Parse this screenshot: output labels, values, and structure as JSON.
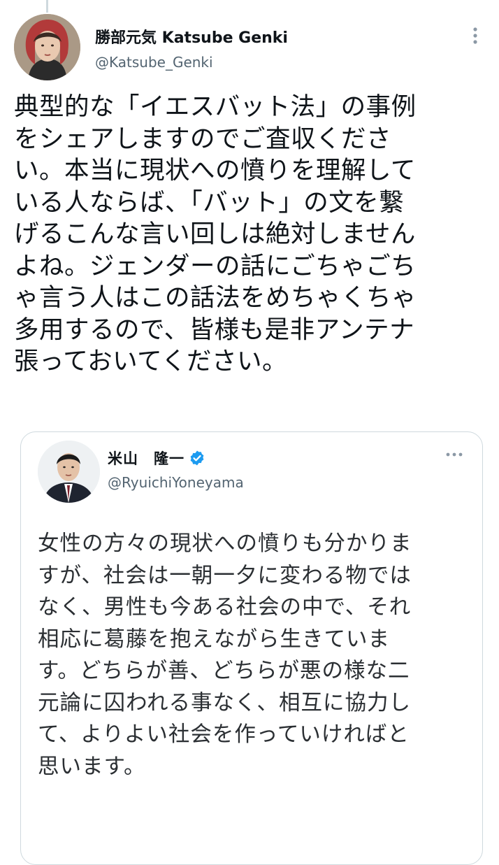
{
  "tweet": {
    "author_name": "勝部元気 Katsube Genki",
    "author_handle": "@Katsube_Genki",
    "text": "典型的な「イエスバット法」の事例\nをシェアしますのでご査収くださ\nい。本当に現状への憤りを理解して\nいる人ならば、「バット」の文を繋\nげるこんな言い回しは絶対しません\nよね。ジェンダーの話にごちゃごち\nゃ言う人はこの話法をめちゃくちゃ\n多用するので、皆様も是非アンテナ\n張っておいてください。",
    "more_icon": "more-vertical-icon"
  },
  "quoted_tweet": {
    "author_name": "米山　隆一",
    "author_handle": "@RyuichiYoneyama",
    "verified_icon": "verified-badge-icon",
    "text": "女性の方々の現状への憤りも分かりま\nすが、社会は一朝一夕に変わる物では\nなく、男性も今ある社会の中で、それ\n相応に葛藤を抱えながら生きていま\nす。どちらが善、どちらが悪の様な二\n元論に囚われる事なく、相互に協力し\nて、よりよい社会を作っていければと\n思います。",
    "more_icon": "more-horizontal-icon"
  },
  "colors": {
    "text": "#0f1419",
    "secondary_text": "#536471",
    "border": "#cfd9de",
    "verified_blue": "#1d9bf0"
  }
}
